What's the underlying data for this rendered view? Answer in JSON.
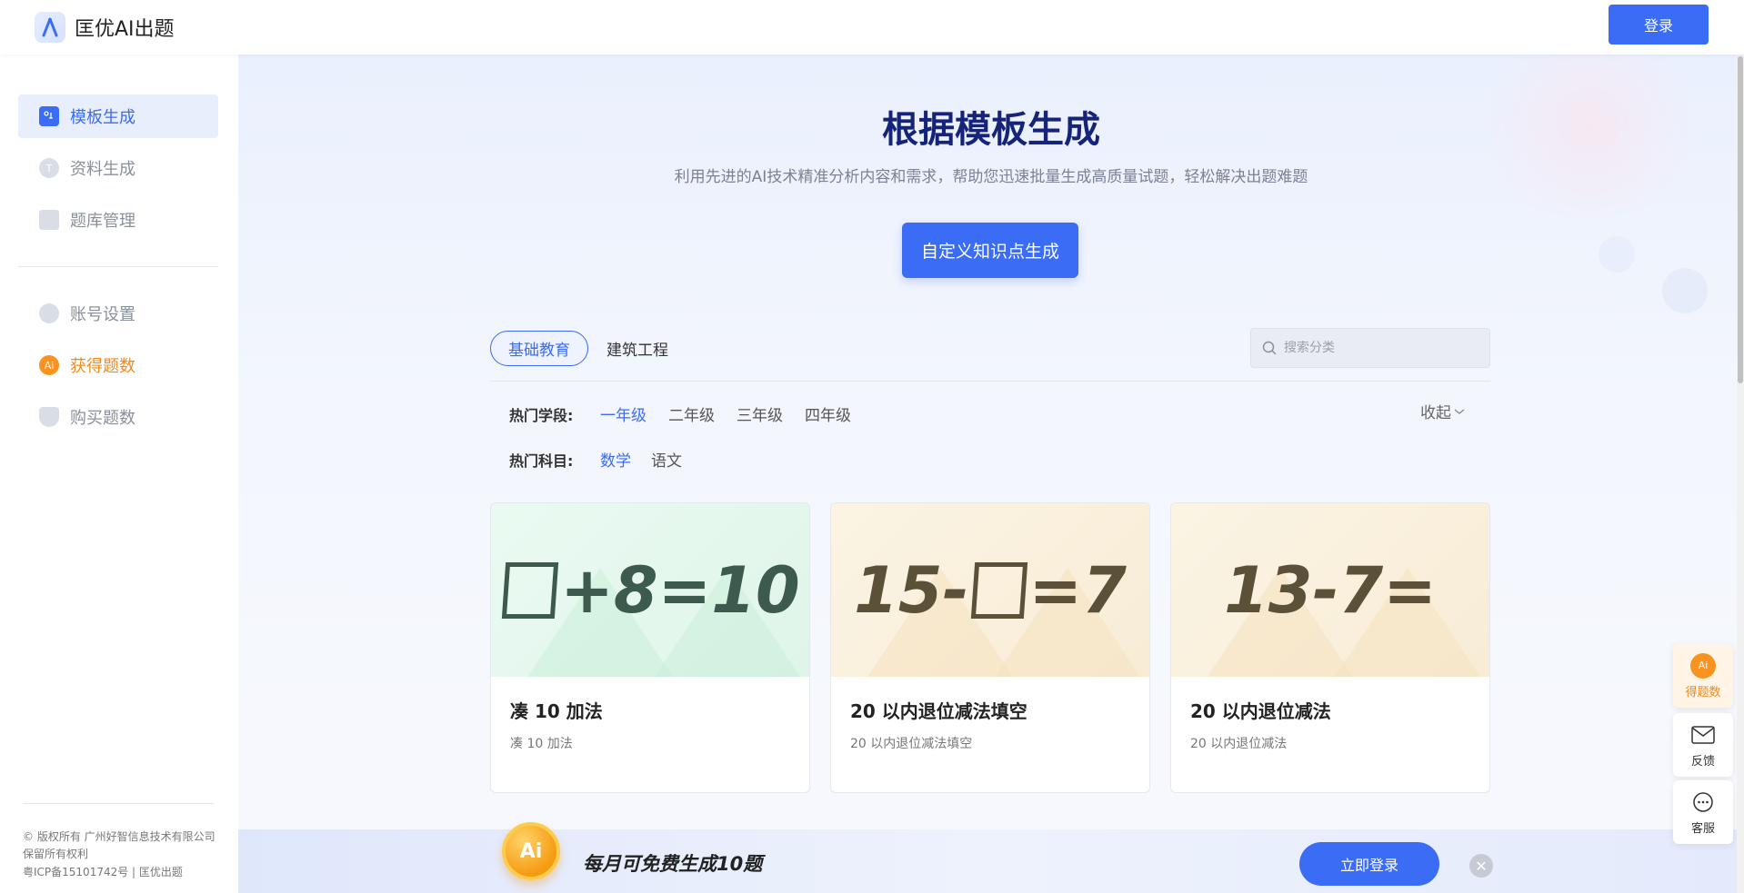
{
  "header": {
    "brand": "匡优AI出题",
    "login_label": "登录"
  },
  "sidebar": {
    "items": [
      {
        "label": "模板生成",
        "icon": "template-icon"
      },
      {
        "label": "资料生成",
        "icon": "material-icon"
      },
      {
        "label": "题库管理",
        "icon": "question-bank-icon"
      },
      {
        "label": "账号设置",
        "icon": "account-icon"
      },
      {
        "label": "获得题数",
        "icon": "ai-coin-icon"
      },
      {
        "label": "购买题数",
        "icon": "diamond-icon"
      }
    ],
    "footer": {
      "line1": "© 版权所有 广州好智信息技术有限公司",
      "line2": "保留所有权利",
      "line3": "粤ICP备15101742号 | 匡优出题"
    }
  },
  "main": {
    "title": "根据模板生成",
    "subtitle": "利用先进的AI技术精准分析内容和需求，帮助您迅速批量生成高质量试题，轻松解决出题难题",
    "custom_button": "自定义知识点生成",
    "tabs": [
      {
        "label": "基础教育",
        "active": true
      },
      {
        "label": "建筑工程",
        "active": false
      }
    ],
    "search_placeholder": "搜索分类",
    "filters": {
      "grade_label": "热门学段:",
      "grades": [
        "一年级",
        "二年级",
        "三年级",
        "四年级"
      ],
      "subject_label": "热门科目:",
      "subjects": [
        "数学",
        "语文"
      ],
      "collapse_label": "收起"
    },
    "cards": [
      {
        "title": "凑 10 加法",
        "desc": "凑 10 加法",
        "eq_prefix": "",
        "eq_suffix": "+8=10",
        "color": "green"
      },
      {
        "title": "20 以内退位减法填空",
        "desc": "20 以内退位减法填空",
        "eq_prefix": "15-",
        "eq_suffix": "=7",
        "color": "yellow"
      },
      {
        "title": "20 以内退位减法",
        "desc": "20 以内退位减法",
        "eq": "13-7=",
        "color": "yellow"
      }
    ]
  },
  "promo": {
    "coin_label": "Ai",
    "text": "每月可免费生成10题",
    "button": "立即登录"
  },
  "float_widgets": {
    "points": "得题数",
    "feedback": "反馈",
    "service": "客服"
  },
  "colors": {
    "primary": "#3a6cf6",
    "title": "#15247a",
    "orange": "#f08a1c"
  }
}
